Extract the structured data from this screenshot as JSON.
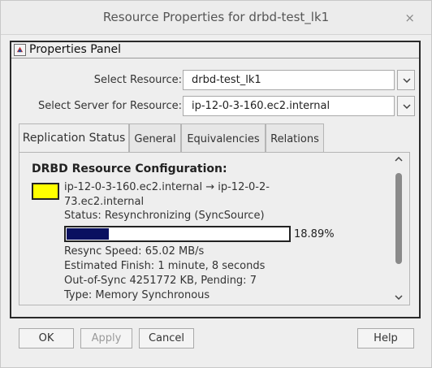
{
  "window": {
    "title": "Resource Properties for drbd-test_lk1",
    "close_label": "×"
  },
  "panel": {
    "title": "Properties Panel",
    "icon": "properties-panel-icon"
  },
  "fields": {
    "resource": {
      "label": "Select Resource:",
      "value": "drbd-test_lk1"
    },
    "server": {
      "label": "Select Server for Resource:",
      "value": "ip-12-0-3-160.ec2.internal"
    }
  },
  "tabs": [
    {
      "label": "Replication Status",
      "active": true
    },
    {
      "label": "General",
      "active": false
    },
    {
      "label": "Equivalencies",
      "active": false
    },
    {
      "label": "Relations",
      "active": false
    }
  ],
  "replication": {
    "heading": "DRBD Resource Configuration:",
    "indicator_color": "#ffff00",
    "connection_line1": "ip-12-0-3-160.ec2.internal → ip-12-0-2-",
    "connection_line2": "73.ec2.internal",
    "status": "Status: Resynchronizing (SyncSource)",
    "progress_fraction": 0.1889,
    "progress_label": "18.89%",
    "resync_speed": "Resync Speed: 65.02 MB/s",
    "estimated_finish": "Estimated Finish: 1 minute, 8 seconds",
    "out_of_sync": "Out-of-Sync 4251772 KB, Pending: 7",
    "type": "Type: Memory Synchronous"
  },
  "buttons": {
    "ok": "OK",
    "apply": "Apply",
    "cancel": "Cancel",
    "help": "Help"
  }
}
